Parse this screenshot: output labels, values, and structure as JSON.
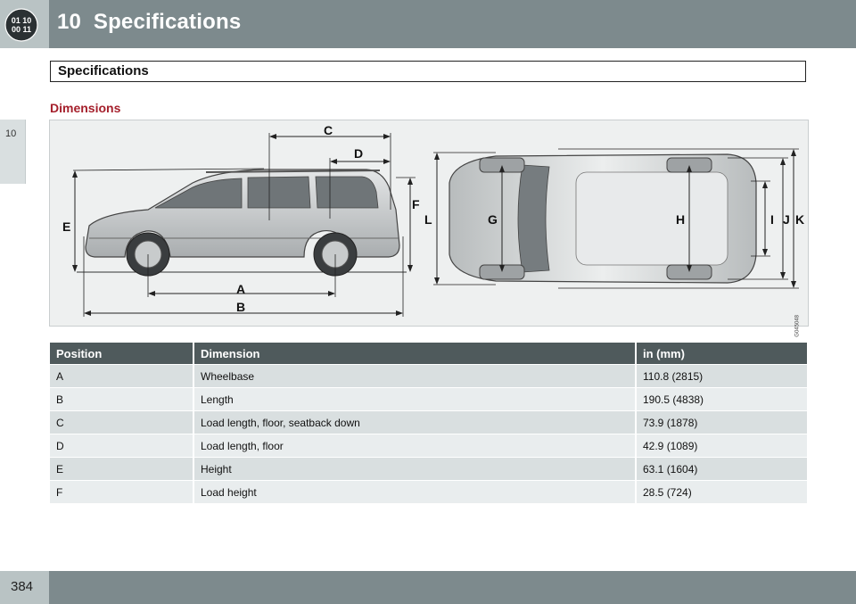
{
  "header": {
    "chapter_number": "10",
    "chapter_title": "Specifications",
    "icon": "specifications-chapter-icon"
  },
  "side_tab": {
    "number": "10"
  },
  "section": {
    "title": "Specifications"
  },
  "subheading": "Dimensions",
  "figure": {
    "code": "G045048",
    "labels": {
      "A": "A",
      "B": "B",
      "C": "C",
      "D": "D",
      "E": "E",
      "F": "F",
      "G": "G",
      "H": "H",
      "I": "I",
      "J": "J",
      "K": "K",
      "L": "L"
    }
  },
  "table": {
    "headers": [
      "Position",
      "Dimension",
      "in (mm)"
    ],
    "rows": [
      [
        "A",
        "Wheelbase",
        "110.8 (2815)"
      ],
      [
        "B",
        "Length",
        "190.5 (4838)"
      ],
      [
        "C",
        "Load length, floor, seatback down",
        "73.9 (1878)"
      ],
      [
        "D",
        "Load length, floor",
        "42.9 (1089)"
      ],
      [
        "E",
        "Height",
        "63.1 (1604)"
      ],
      [
        "F",
        "Load height",
        "28.5 (724)"
      ]
    ]
  },
  "footer": {
    "page_number": "384"
  },
  "colors": {
    "header_bg": "#7d8a8d",
    "accent_red": "#a5202c",
    "table_header_bg": "#4f5a5c"
  }
}
